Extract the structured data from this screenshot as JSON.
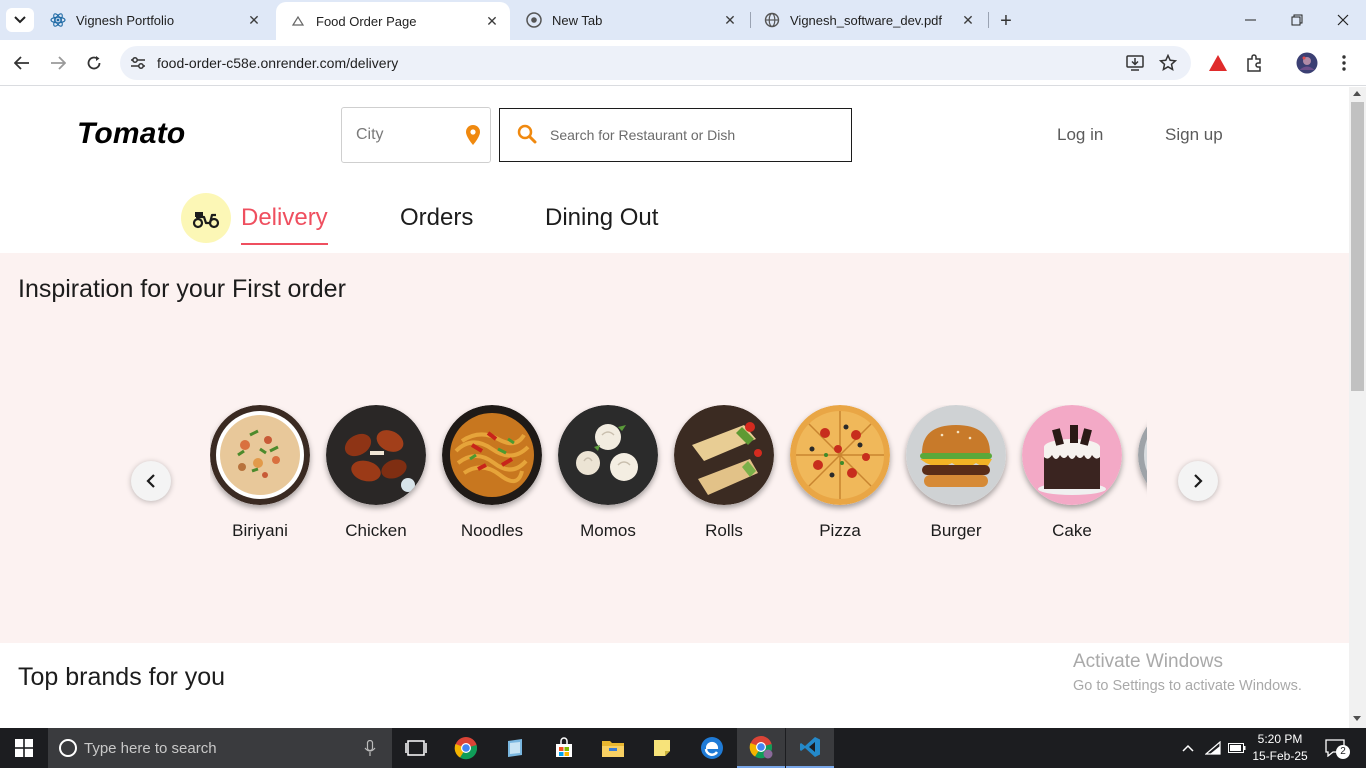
{
  "browser": {
    "tabs": [
      {
        "title": "Vignesh Portfolio",
        "active": false
      },
      {
        "title": "Food Order Page",
        "active": true
      },
      {
        "title": "New Tab",
        "active": false
      },
      {
        "title": "Vignesh_software_dev.pdf",
        "active": false
      }
    ],
    "url": "food-order-c58e.onrender.com/delivery"
  },
  "header": {
    "logo": "Tomato",
    "city_placeholder": "City",
    "search_placeholder": "Search for Restaurant or Dish",
    "login": "Log in",
    "signup": "Sign up"
  },
  "nav_tabs": [
    {
      "label": "Delivery",
      "active": true
    },
    {
      "label": "Orders",
      "active": false
    },
    {
      "label": "Dining Out",
      "active": false
    }
  ],
  "inspiration": {
    "title": "Inspiration for your First order",
    "items": [
      {
        "label": "Biriyani",
        "icon": "biriyani-image"
      },
      {
        "label": "Chicken",
        "icon": "chicken-image"
      },
      {
        "label": "Noodles",
        "icon": "noodles-image"
      },
      {
        "label": "Momos",
        "icon": "momos-image"
      },
      {
        "label": "Rolls",
        "icon": "rolls-image"
      },
      {
        "label": "Pizza",
        "icon": "pizza-image"
      },
      {
        "label": "Burger",
        "icon": "burger-image"
      },
      {
        "label": "Cake",
        "icon": "cake-image"
      },
      {
        "label": "",
        "icon": "partial-food-image"
      }
    ]
  },
  "top_brands": {
    "title": "Top brands for you"
  },
  "watermark": {
    "title": "Activate Windows",
    "subtitle": "Go to Settings to activate Windows."
  },
  "taskbar": {
    "search_placeholder": "Type here to search",
    "time": "5:20 PM",
    "date": "15-Feb-25",
    "notification_count": "2"
  },
  "colors": {
    "brand_red": "#ef4f5f",
    "inspiration_bg": "#fcf2f1",
    "delivery_icon_bg": "#fcf7b6",
    "search_icon": "#f0890f"
  }
}
